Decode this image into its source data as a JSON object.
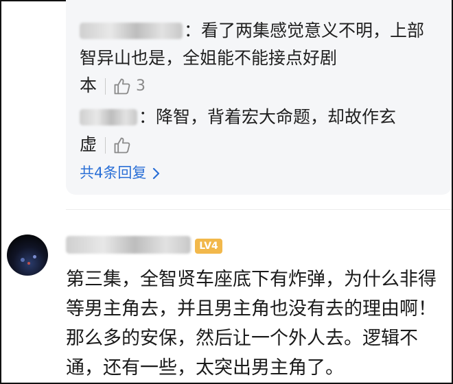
{
  "replies": [
    {
      "text_lines": [
        "：看了两集感觉意义不明，上部",
        "智异山也是，全姐能不能接点好剧",
        "本"
      ],
      "like_count": "3"
    },
    {
      "text_lines": [
        "：降智，背着宏大命题，却故作玄",
        "虚"
      ]
    }
  ],
  "more_replies_label": "共4条回复",
  "comment": {
    "level_badge": "LV4",
    "text": "第三集，全智贤车座底下有炸弹，为什么非得等男主角去，并且男主角也没有去的理由啊！那么多的安保，然后让一个外人去。逻辑不通，还有一些，太突出男主角了。"
  },
  "icons": {
    "like": "thumbs-up-icon",
    "more": "chevron-right-icon"
  },
  "colors": {
    "link": "#2a6fd6",
    "reply_bg": "#f5f6f8",
    "badge": "#f2b84b"
  }
}
